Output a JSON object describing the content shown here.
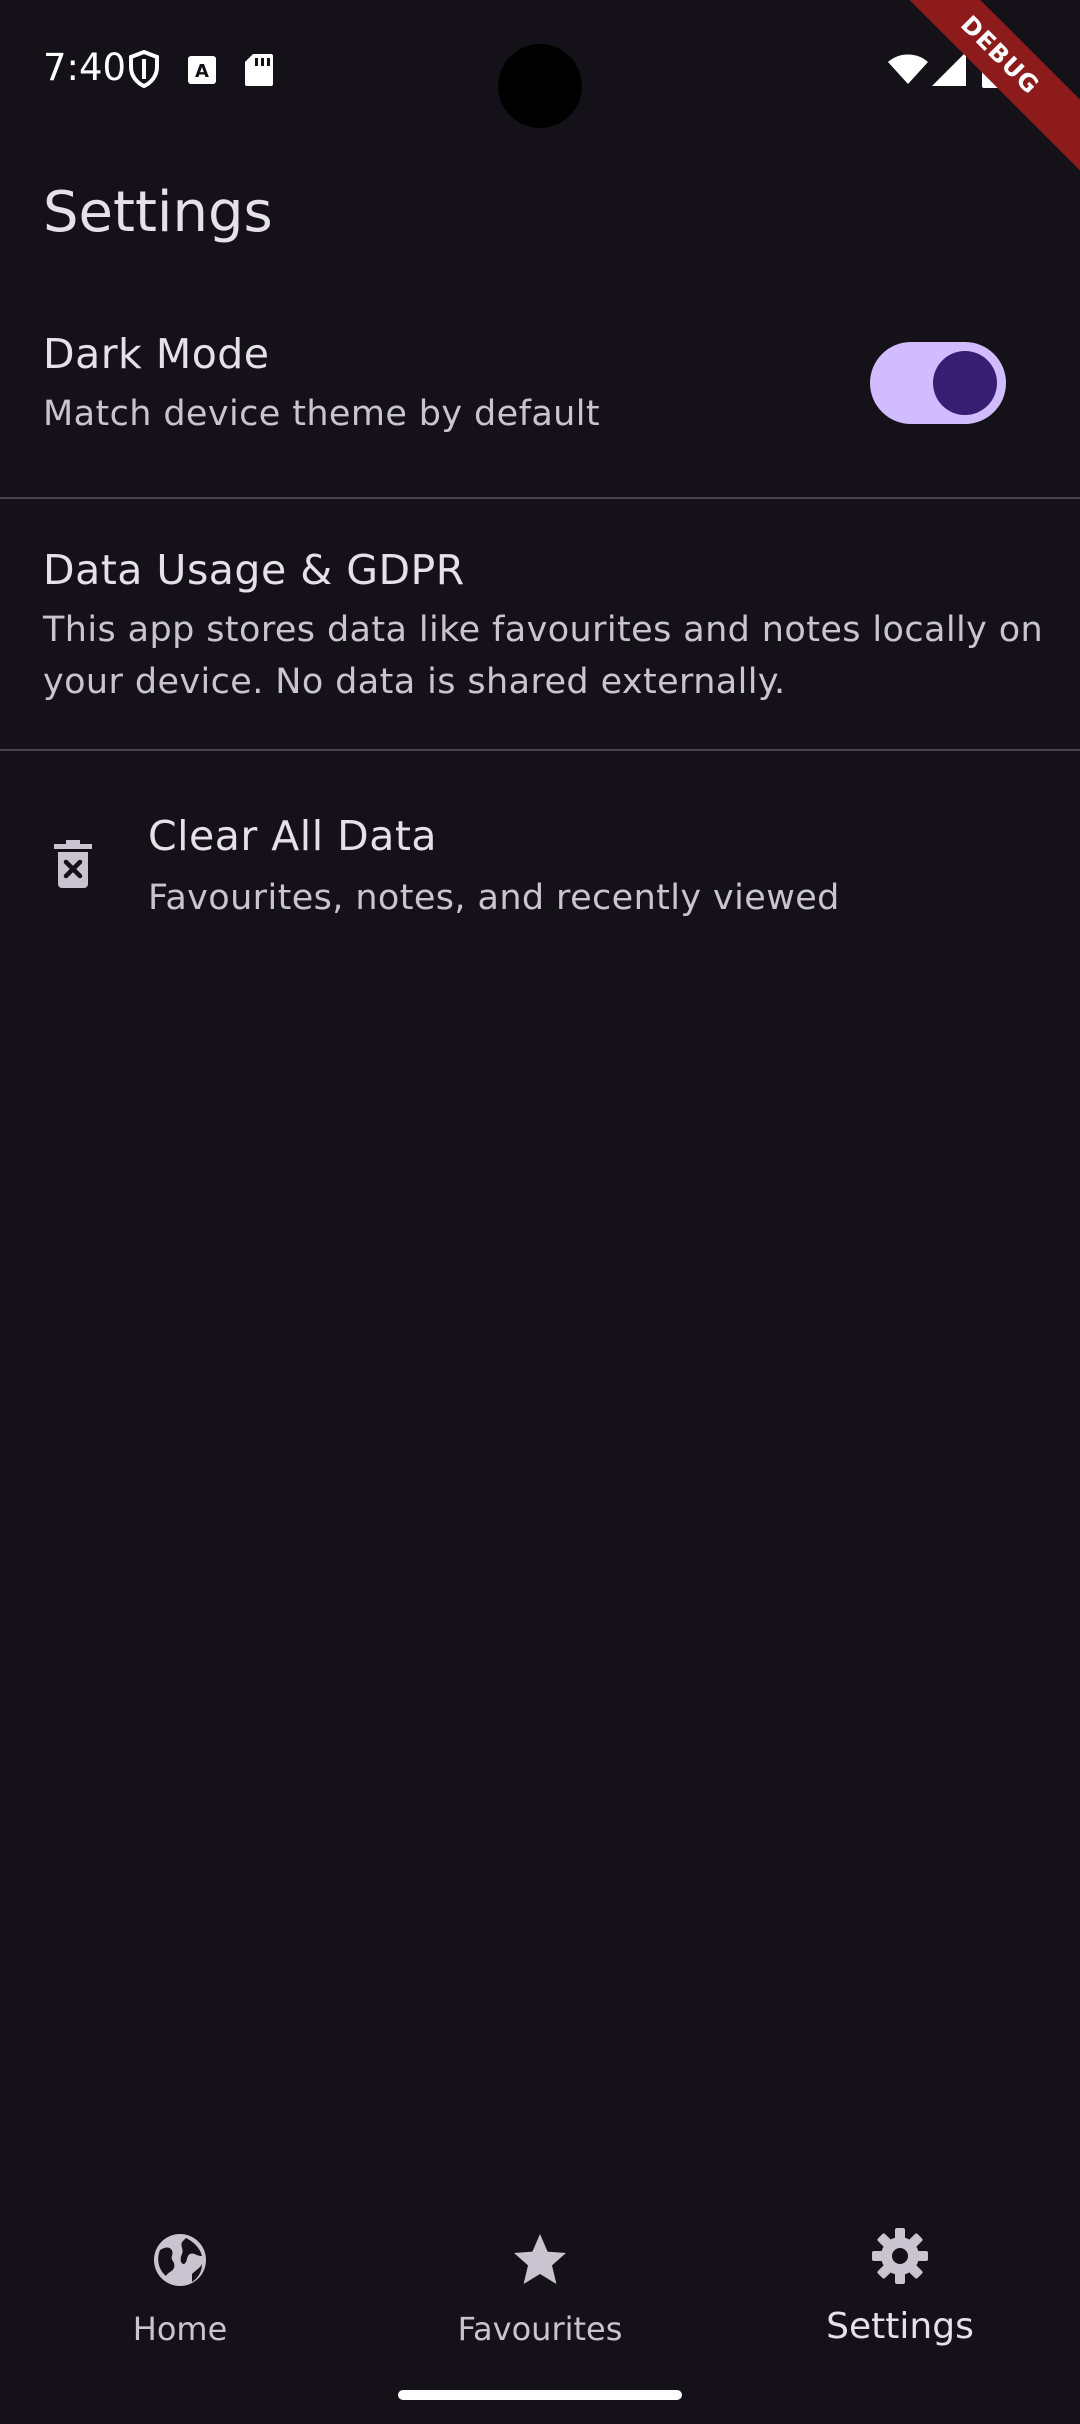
{
  "status_bar": {
    "time": "7:40",
    "debug_banner": "DEBUG",
    "icons": [
      "shield-icon",
      "keyboard-a-icon",
      "sd-card-icon",
      "wifi-icon",
      "signal-icon",
      "battery-icon"
    ]
  },
  "page": {
    "title": "Settings"
  },
  "settings": {
    "dark_mode": {
      "title": "Dark Mode",
      "subtitle": "Match device theme by default",
      "enabled": true
    },
    "data_usage": {
      "title": "Data Usage & GDPR",
      "description_line1": "This app stores data like favourites and notes locally on",
      "description_line2": "your device. No data is shared externally."
    },
    "clear_data": {
      "title": "Clear All Data",
      "subtitle": "Favourites, notes, and recently viewed",
      "icon": "delete-forever-icon"
    }
  },
  "bottom_nav": {
    "items": [
      {
        "label": "Home",
        "icon": "globe-icon",
        "active": false
      },
      {
        "label": "Favourites",
        "icon": "star-icon",
        "active": false
      },
      {
        "label": "Settings",
        "icon": "gear-icon",
        "active": true
      }
    ]
  },
  "colors": {
    "background": "#141218",
    "toggle_track": "#D0BCFF",
    "toggle_knob": "#381E72",
    "divider": "#49454F",
    "debug_banner": "#8E1B1B"
  }
}
